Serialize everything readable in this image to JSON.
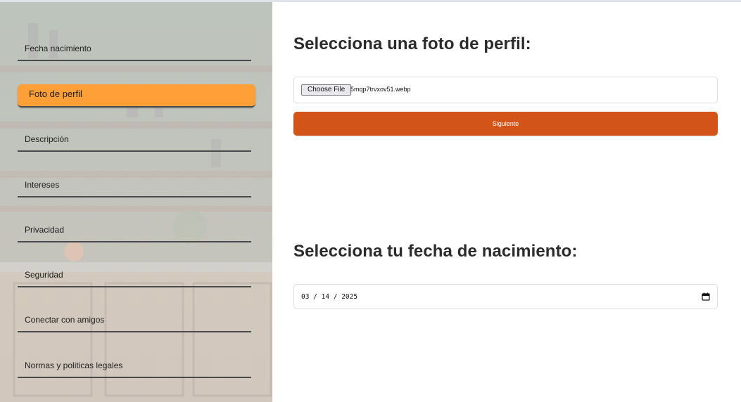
{
  "sidebar": {
    "items": [
      {
        "label": "Fecha nacimiento",
        "active": false
      },
      {
        "label": "Foto de perfil",
        "active": true
      },
      {
        "label": "Descripción",
        "active": false
      },
      {
        "label": "Intereses",
        "active": false
      },
      {
        "label": "Privacidad",
        "active": false
      },
      {
        "label": "Seguridad",
        "active": false
      },
      {
        "label": "Conectar con amigos",
        "active": false
      },
      {
        "label": "Normas y politicas legales",
        "active": false
      }
    ],
    "active_color": "#ff9f38"
  },
  "photo_section": {
    "title": "Selecciona una foto de perfil:",
    "choose_file_label": "Choose File",
    "file_name": "5mqp7trvxov51.webp",
    "submit_label": "Siguiente",
    "submit_color": "#d35418"
  },
  "birthdate_section": {
    "title": "Selecciona tu fecha de nacimiento:",
    "date_value": "03 / 14 / 2025",
    "calendar_icon": "calendar-icon"
  }
}
